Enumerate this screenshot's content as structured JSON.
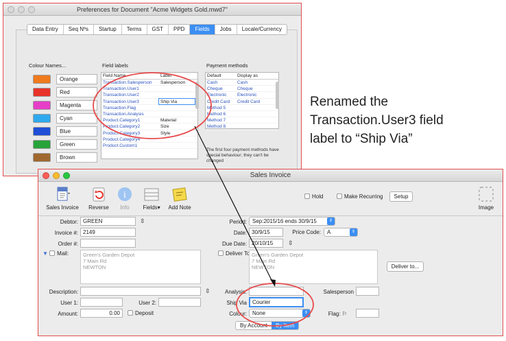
{
  "prefs": {
    "title": "Preferences for Document \"Acme Widgets Gold.mwd7\"",
    "tabs": [
      "Data Entry",
      "Seq Nºs",
      "Startup",
      "Terms",
      "GST",
      "PPD",
      "Fields",
      "Jobs",
      "Locale/Currency"
    ],
    "active_tab": "Fields",
    "colour_heading": "Colour Names...",
    "colours": [
      {
        "name": "Orange",
        "hex": "#f07a1e"
      },
      {
        "name": "Red",
        "hex": "#e8332a"
      },
      {
        "name": "Magenta",
        "hex": "#e63fc8"
      },
      {
        "name": "Cyan",
        "hex": "#2fa9ee"
      },
      {
        "name": "Blue",
        "hex": "#1f4fd6"
      },
      {
        "name": "Green",
        "hex": "#27a33a"
      },
      {
        "name": "Brown",
        "hex": "#a0692f"
      }
    ],
    "field_labels_heading": "Field labels",
    "field_table": {
      "headers": [
        "Field Name",
        "Label"
      ],
      "rows": [
        [
          "Transaction.Salesperson",
          "Salesperson"
        ],
        [
          "Transaction.User1",
          ""
        ],
        [
          "Transaction.User2",
          ""
        ],
        [
          "Transaction.User3",
          "Ship Via"
        ],
        [
          "Transaction.Flag",
          ""
        ],
        [
          "Transaction.Analysis",
          ""
        ],
        [
          "Product.Category1",
          "Material"
        ],
        [
          "Product.Category2",
          "Size"
        ],
        [
          "Product.Category3",
          "Style"
        ],
        [
          "Product.Category4",
          ""
        ],
        [
          "Product.Custom1",
          ""
        ]
      ]
    },
    "payment_heading": "Payment methods",
    "payment_table": {
      "headers": [
        "Default",
        "Display as"
      ],
      "rows": [
        [
          "Cash",
          "Cash"
        ],
        [
          "Cheque",
          "Cheque"
        ],
        [
          "Electronic",
          "Electronic"
        ],
        [
          "Credit Card",
          "Credit Card"
        ],
        [
          "Method 5",
          ""
        ],
        [
          "Method 6",
          ""
        ],
        [
          "Method 7",
          ""
        ],
        [
          "Method 8",
          ""
        ]
      ]
    },
    "payment_note": "The first four payment methods have special behaviour; they can't be changed"
  },
  "callout": {
    "line1": "Renamed the",
    "line2": "Transaction.User3 field",
    "line3": "label to “Ship Via”"
  },
  "invoice": {
    "title": "Sales Invoice",
    "toolbar": {
      "sales_invoice": "Sales Invoice",
      "reverse": "Reverse",
      "info": "Info",
      "fields": "Fields",
      "add_note": "Add Note",
      "hold": "Hold",
      "make_recurring": "Make Recurring",
      "setup": "Setup",
      "image": "Image"
    },
    "labels": {
      "debtor": "Debtor:",
      "invoice_no": "Invoice #:",
      "order_no": "Order #:",
      "mail": "Mail:",
      "description": "Description:",
      "user1": "User 1:",
      "user2": "User 2:",
      "amount": "Amount:",
      "deposit": "Deposit",
      "period": "Period:",
      "date": "Date:",
      "price_code": "Price Code:",
      "due_date": "Due Date:",
      "deliver_to": "Deliver To:",
      "deliver_button": "Deliver to...",
      "analysis": "Analysis:",
      "salesperson": "Salesperson",
      "ship_via": "Ship Via",
      "colour": "Colour:",
      "flag": "Flag:"
    },
    "values": {
      "debtor": "GREEN",
      "invoice_no": "2149",
      "order_no": "",
      "mail_address": [
        "Green's Garden Depot",
        "7 Main Rd",
        "NEWTON"
      ],
      "period": "Sep:2015/16 ends 30/9/15",
      "date": "30/9/15",
      "price_code": "A",
      "due_date": "20/10/15",
      "deliver_address": [
        "Green's Garden Depot",
        "7 Main Rd",
        "NEWTON"
      ],
      "amount": "0.00",
      "ship_via": "Courier",
      "colour": "None"
    },
    "segments": [
      "By Account",
      "By Item"
    ],
    "active_segment": "By Item"
  },
  "colors": {
    "highlight_ring": "#e84a4a",
    "accent": "#3b8ef3"
  }
}
